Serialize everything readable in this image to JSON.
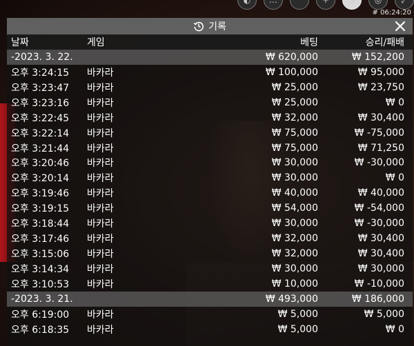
{
  "topbar": {
    "timestamp": "# 06:24:20",
    "buttons": [
      {
        "icon": "zoom-icon",
        "label": "◐"
      },
      {
        "icon": "chat-icon",
        "label": "…"
      },
      {
        "icon": "quote-icon",
        "label": "“"
      },
      {
        "icon": "plus-icon",
        "label": "+"
      },
      {
        "icon": "history-icon",
        "label": "◷"
      },
      {
        "icon": "settings-icon",
        "label": "◎"
      },
      {
        "icon": "expand-icon",
        "label": "⤢"
      }
    ]
  },
  "panel": {
    "title": "기록",
    "columns": {
      "date": "날짜",
      "game": "게임",
      "bet": "베팅",
      "win": "승리/패배"
    },
    "groups": [
      {
        "date": "-2023. 3. 22.",
        "bet_total": "₩ 620,000",
        "win_total": "₩ 152,200",
        "rows": [
          {
            "time": "오후 3:24:15",
            "game": "바카라",
            "bet": "₩ 100,000",
            "win": "₩ 95,000"
          },
          {
            "time": "오후 3:23:47",
            "game": "바카라",
            "bet": "₩ 25,000",
            "win": "₩ 23,750"
          },
          {
            "time": "오후 3:23:16",
            "game": "바카라",
            "bet": "₩ 25,000",
            "win": "₩ 0"
          },
          {
            "time": "오후 3:22:45",
            "game": "바카라",
            "bet": "₩ 32,000",
            "win": "₩ 30,400"
          },
          {
            "time": "오후 3:22:14",
            "game": "바카라",
            "bet": "₩ 75,000",
            "win": "₩ -75,000"
          },
          {
            "time": "오후 3:21:44",
            "game": "바카라",
            "bet": "₩ 75,000",
            "win": "₩ 71,250"
          },
          {
            "time": "오후 3:20:46",
            "game": "바카라",
            "bet": "₩ 30,000",
            "win": "₩ -30,000"
          },
          {
            "time": "오후 3:20:14",
            "game": "바카라",
            "bet": "₩ 30,000",
            "win": "₩ 0"
          },
          {
            "time": "오후 3:19:46",
            "game": "바카라",
            "bet": "₩ 40,000",
            "win": "₩ 40,000"
          },
          {
            "time": "오후 3:19:15",
            "game": "바카라",
            "bet": "₩ 54,000",
            "win": "₩ -54,000"
          },
          {
            "time": "오후 3:18:44",
            "game": "바카라",
            "bet": "₩ 30,000",
            "win": "₩ -30,000"
          },
          {
            "time": "오후 3:17:46",
            "game": "바카라",
            "bet": "₩ 32,000",
            "win": "₩ 30,400"
          },
          {
            "time": "오후 3:15:06",
            "game": "바카라",
            "bet": "₩ 32,000",
            "win": "₩ 30,400"
          },
          {
            "time": "오후 3:14:34",
            "game": "바카라",
            "bet": "₩ 30,000",
            "win": "₩ 30,000"
          },
          {
            "time": "오후 3:10:53",
            "game": "바카라",
            "bet": "₩ 10,000",
            "win": "₩ -10,000"
          }
        ]
      },
      {
        "date": "-2023. 3. 21.",
        "bet_total": "₩ 493,000",
        "win_total": "₩ 186,000",
        "rows": [
          {
            "time": "오후 6:19:00",
            "game": "바카라",
            "bet": "₩ 5,000",
            "win": "₩ 5,000"
          },
          {
            "time": "오후 6:18:35",
            "game": "바카라",
            "bet": "₩ 5,000",
            "win": "₩ 0"
          }
        ]
      }
    ]
  }
}
